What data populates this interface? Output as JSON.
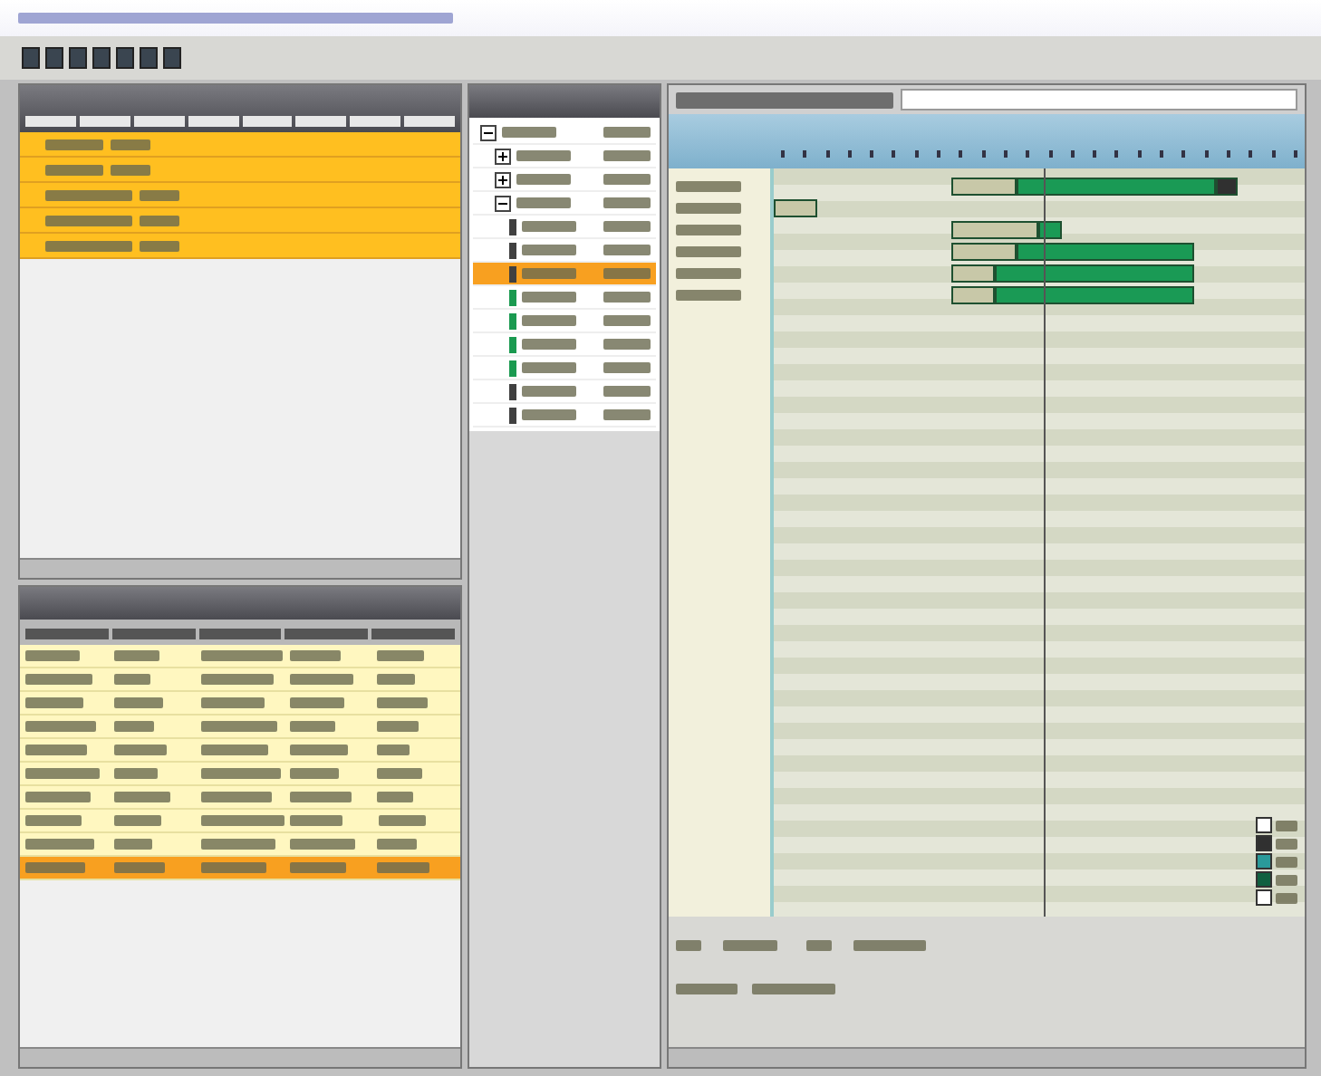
{
  "window": {
    "kind": "blurred-title"
  },
  "toolbar": {
    "buttons": [
      {
        "kind": "tool"
      },
      {
        "kind": "tool"
      },
      {
        "kind": "tool"
      },
      {
        "kind": "tool"
      },
      {
        "kind": "tool"
      },
      {
        "kind": "tool"
      },
      {
        "kind": "tool"
      }
    ]
  },
  "orders_table": {
    "columns": [
      {
        "kind": "blurred"
      },
      {
        "kind": "blurred"
      },
      {
        "kind": "blurred"
      },
      {
        "kind": "blurred"
      },
      {
        "kind": "blurred"
      },
      {
        "kind": "blurred"
      },
      {
        "kind": "blurred"
      },
      {
        "kind": "blurred"
      }
    ],
    "rows": [
      {
        "selected": true
      },
      {
        "selected": true
      },
      {
        "selected": true
      },
      {
        "selected": true
      },
      {
        "selected": true
      }
    ]
  },
  "operations_table": {
    "columns": [
      {
        "kind": "blurred"
      },
      {
        "kind": "blurred"
      },
      {
        "kind": "blurred"
      },
      {
        "kind": "blurred"
      },
      {
        "kind": "blurred"
      }
    ],
    "rows": [
      {
        "selected": false
      },
      {
        "selected": false
      },
      {
        "selected": false
      },
      {
        "selected": false
      },
      {
        "selected": false
      },
      {
        "selected": false
      },
      {
        "selected": false
      },
      {
        "selected": false
      },
      {
        "selected": false
      },
      {
        "selected": true
      }
    ]
  },
  "tree": {
    "items": [
      {
        "expanded": true,
        "selected": false,
        "children": [
          {
            "expanded": false,
            "selected": false
          },
          {
            "expanded": false,
            "selected": false
          },
          {
            "expanded": true,
            "selected": false,
            "children": [
              {
                "selected": false,
                "color": "#404040"
              },
              {
                "selected": false,
                "color": "#404040"
              },
              {
                "selected": true,
                "color": "#404040"
              },
              {
                "selected": false,
                "color": "#1a9a50"
              },
              {
                "selected": false,
                "color": "#1a9a50"
              },
              {
                "selected": false,
                "color": "#1a9a50"
              },
              {
                "selected": false,
                "color": "#1a9a50"
              },
              {
                "selected": false,
                "color": "#404040"
              },
              {
                "selected": false,
                "color": "#404040"
              }
            ]
          }
        ]
      }
    ]
  },
  "gantt": {
    "rows": [
      {
        "segments": [
          {
            "kind": "label"
          },
          {
            "kind": "bar"
          },
          {
            "kind": "end"
          }
        ]
      },
      {
        "segments": [
          {
            "kind": "label"
          }
        ]
      },
      {
        "segments": [
          {
            "kind": "label"
          },
          {
            "kind": "bar"
          }
        ]
      },
      {
        "segments": [
          {
            "kind": "label"
          },
          {
            "kind": "bar"
          }
        ]
      },
      {
        "segments": [
          {
            "kind": "label"
          },
          {
            "kind": "bar"
          }
        ]
      },
      {
        "segments": [
          {
            "kind": "label"
          },
          {
            "kind": "bar"
          }
        ]
      }
    ],
    "legend": [
      {
        "color": "#ffffff"
      },
      {
        "color": "#303030"
      },
      {
        "color": "#2a9a9a"
      },
      {
        "color": "#106040"
      },
      {
        "color": "#ffffff"
      }
    ]
  }
}
